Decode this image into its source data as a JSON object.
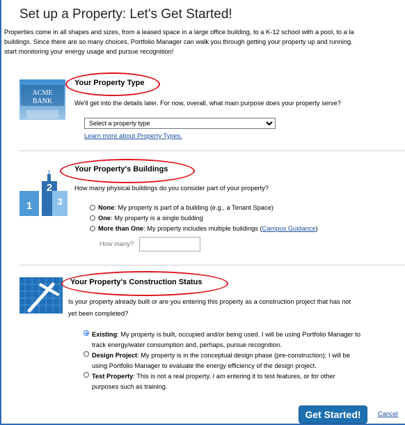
{
  "page_title": "Set up a Property: Let's Get Started!",
  "intro_lines": [
    "Properties come in all shapes and sizes, from a leased space in a large office building, to a K-12 school with a pool, to a la",
    "buildings. Since there are so many choices, Portfolio Manager can walk you through getting your property up and running.",
    "start monitoring your energy usage and pursue recognition!"
  ],
  "type_section": {
    "logo_lines": [
      "ACME",
      "BANK"
    ],
    "heading": "Your Property Type",
    "description": "We'll get into the details later. For now, overall, what main purpose does your property serve?",
    "select_value": "Select a property type",
    "learn_more_link": "Learn more about Property Types."
  },
  "buildings_section": {
    "heading": "Your Property's Buildings",
    "question": "How many physical buildings do you consider part of your property?",
    "icon_numbers": [
      "1",
      "2",
      "3"
    ],
    "options": [
      {
        "bold": "None",
        "text": ": My property is part of a building (e.g., a Tenant Space)",
        "link": "",
        "after": ""
      },
      {
        "bold": "One",
        "text": ": My property is a single building",
        "link": "",
        "after": ""
      },
      {
        "bold": "More than One",
        "text": ": My property includes multiple buildings (",
        "link": "Campus Guidance",
        "after": ")"
      }
    ],
    "how_many_label": "How many?",
    "how_many_value": ""
  },
  "construction_section": {
    "heading": "Your Property's Construction Status",
    "question_lines": [
      "Is your property already built or are you entering this property as a construction project that has not",
      "yet been completed?"
    ],
    "options": [
      {
        "bold": "Existing",
        "lines": [
          ": My property is built, occupied and/or being used. I will be using Portfolio Manager to",
          "track energy/water consumption and, perhaps, pursue recognition."
        ],
        "selected": true
      },
      {
        "bold": "Design Project",
        "lines": [
          ": My property is in the conceptual design phase (pre-construction); I will be",
          "using Portfolio Manager to evaluate the energy efficiency of the design project."
        ],
        "selected": false
      },
      {
        "bold": "Test Property",
        "lines": [
          ": This is not a real property. I am entering it to test features, or for other",
          "purposes such as training."
        ],
        "selected": false
      }
    ]
  },
  "actions": {
    "get_started": "Get Started!",
    "cancel": "Cancel"
  }
}
